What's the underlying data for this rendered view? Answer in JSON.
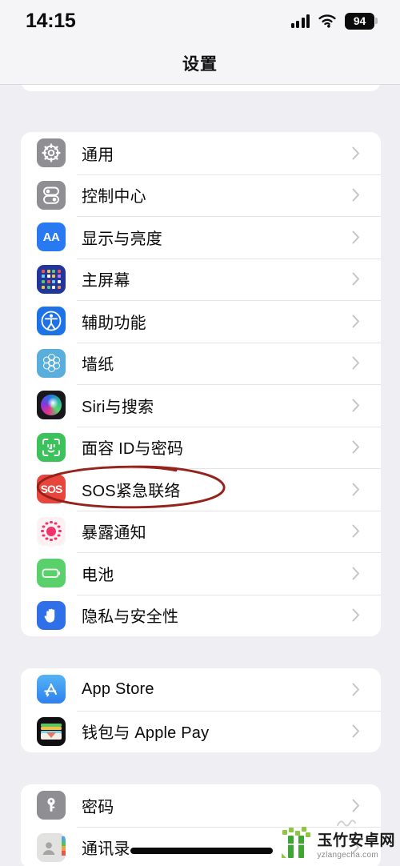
{
  "status_bar": {
    "time": "14:15",
    "cellular_icon": "signal-bars-icon",
    "wifi_icon": "wifi-icon",
    "battery_icon": "battery-icon",
    "battery_percent": "94"
  },
  "nav": {
    "title": "设置"
  },
  "sections": [
    {
      "id": "section-partial-top",
      "rows": [
        {
          "label": "",
          "icon": "purple-app-icon",
          "icon_color": "#4B4BD4",
          "chevron": true
        }
      ]
    },
    {
      "id": "section-system",
      "rows": [
        {
          "label": "通用",
          "icon": "gear-icon",
          "icon_color": "#8E8E93",
          "chevron": true
        },
        {
          "label": "控制中心",
          "icon": "control-center-icon",
          "icon_color": "#8E8E93",
          "chevron": true
        },
        {
          "label": "显示与亮度",
          "icon": "display-brightness-icon",
          "icon_color": "#2979F2",
          "chevron": true
        },
        {
          "label": "主屏幕",
          "icon": "home-screen-icon",
          "icon_color": "#2B4FCF",
          "chevron": true
        },
        {
          "label": "辅助功能",
          "icon": "accessibility-icon",
          "icon_color": "#1E72E8",
          "chevron": true
        },
        {
          "label": "墙纸",
          "icon": "wallpaper-icon",
          "icon_color": "#5AAEDC",
          "chevron": true
        },
        {
          "label": "Siri与搜索",
          "icon": "siri-icon",
          "icon_color": "#1A1A20",
          "chevron": true
        },
        {
          "label": "面容 ID与密码",
          "icon": "face-id-icon",
          "icon_color": "#3CC25B",
          "chevron": true
        },
        {
          "label": "SOS紧急联络",
          "icon": "sos-icon",
          "icon_color": "#E8453C",
          "chevron": true
        },
        {
          "label": "暴露通知",
          "icon": "exposure-notification-icon",
          "icon_color": "#FDF2F5",
          "chevron": true
        },
        {
          "label": "电池",
          "icon": "battery-settings-icon",
          "icon_color": "#5AD06A",
          "chevron": true
        },
        {
          "label": "隐私与安全性",
          "icon": "privacy-hand-icon",
          "icon_color": "#2F6FE8",
          "chevron": true
        }
      ]
    },
    {
      "id": "section-store",
      "rows": [
        {
          "label": "App Store",
          "icon": "app-store-icon",
          "icon_color": "#3E9BF0",
          "chevron": true
        },
        {
          "label": "钱包与 Apple Pay",
          "icon": "wallet-icon",
          "icon_color": "#101013",
          "chevron": true
        }
      ]
    },
    {
      "id": "section-accounts",
      "rows": [
        {
          "label": "密码",
          "icon": "passwords-key-icon",
          "icon_color": "#8E8E93",
          "chevron": true
        },
        {
          "label": "通讯录",
          "icon": "contacts-icon",
          "icon_color": "#D6D6D6",
          "chevron": true
        }
      ]
    }
  ],
  "annotation": {
    "type": "hand-drawn-ellipse",
    "color": "#96221C",
    "targets": "SOS紧急联络"
  },
  "watermark": {
    "title": "玉竹安卓网",
    "url": "yzlangecha.com",
    "logo_color": "#3FA535"
  },
  "colors": {
    "page_background": "#EFEFF3",
    "card_background": "#FFFFFF",
    "separator": "#E4E4E8",
    "primary_text": "#0A0A0A",
    "chevron": "#C4C4C9",
    "nav_background": "#F5F5F7"
  }
}
